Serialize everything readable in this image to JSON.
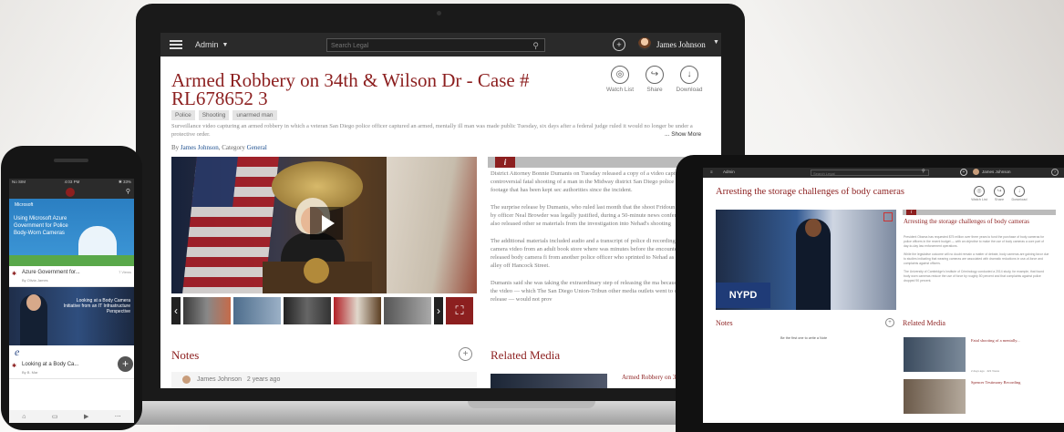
{
  "laptop": {
    "topbar": {
      "admin": "Admin",
      "search_placeholder": "Search Legal",
      "user": "James Johnson"
    },
    "title": "Armed Robbery on 34th & Wilson Dr - Case # RL678652 3",
    "actions": [
      "Watch List",
      "Share",
      "Download"
    ],
    "tags": [
      "Police",
      "Shooting",
      "unarmed man"
    ],
    "description": "Surveillance video capturing an armed robbery in which a veteran San Diego police officer captured an armed, mentally ill man was made public Tuesday, six days after a federal judge ruled it would no longer be under a protective order.",
    "show_more": "... Show More",
    "byline": {
      "prefix": "By",
      "author": "James Johnson",
      "mid": ", Category",
      "category": "General"
    },
    "info_icon": "i",
    "article": [
      "District Attorney Bonnie Dumanis on Tuesday released a copy of a video captured the controversial fatal shooting of a man in the Midway district San Diego police officer April 30, footage that has been kept sec authorities since the incident.",
      "The surprise release by Dumanis, who ruled last month that the shoot Fridoun Rawshan Nehad by officer Neal Browder was legally justified, during a 50-minute news conference, where she also released other se materials from the investigation into Nehad's shooting",
      "The additional materials included audio and a transcript of police di recordings and security camera video from an adult book store where was minutes before the encounter. She also released body camera fi from another police officer who sprinted to Nehad as he lay bleeding alley off Hancock Street.",
      "Dumanis said she was taking the extraordinary step of releasing the ma because showing only the video — which The San Diego Union-Tribun other media outlets went to court to gain release — would not prov"
    ],
    "notes_heading": "Notes",
    "note_author": "James Johnson",
    "note_time": "2 years ago",
    "related_heading": "Related Media",
    "related_item": "Armed Robbery on 34"
  },
  "phone": {
    "status_left": "No SIM",
    "status_time": "4:03 PM",
    "status_right": "✱ 33%",
    "card1_brand": "Microsoft",
    "card1_caption": "Using Microsoft Azure Government for Police Body-Worn Cameras",
    "row1_title": "Azure Government for...",
    "row1_sub": "By Olivia James",
    "row1_views": "7 Views",
    "card2_caption": "Looking at a Body Camera Initiative from an IT Infrastructure Perspective",
    "row2_title": "Looking at a Body Ca...",
    "row2_sub": "By B. Mar"
  },
  "tablet": {
    "admin": "Admin",
    "search_placeholder": "Search Legal",
    "user": "James Johnson",
    "title": "Arresting the storage challenges of body cameras",
    "actions": [
      "Watch List",
      "Share",
      "Download"
    ],
    "info_icon": "i",
    "article_title": "Arresting the storage challenges of body cameras",
    "article": [
      "President Obama has requested $75 million over three years to fund the purchase of body cameras for police officers in the recent budget — with an objective to make the use of body cameras a core part of day-to-day law enforcement operations.",
      "While the legislative outcome will no doubt remain a matter of debate, body cameras are gaining favor due to studies indicating that wearing cameras are associated with dramatic reductions in use-of-force and complaints against officers.",
      "The University of Cambridge's Institute of Criminology conducted a 2014 study, for example, that found body worn cameras reduce the use of force by roughly 50 percent and that complaints against police dropped 90 percent."
    ],
    "notes_heading": "Notes",
    "first_note": "Be the first one to write a Note",
    "related_heading": "Related Media",
    "related": [
      {
        "title": "Fatal shooting of a mentally...",
        "meta": "2 days ago · 421 Views"
      },
      {
        "title": "Spencer Testimony Recording"
      }
    ]
  }
}
